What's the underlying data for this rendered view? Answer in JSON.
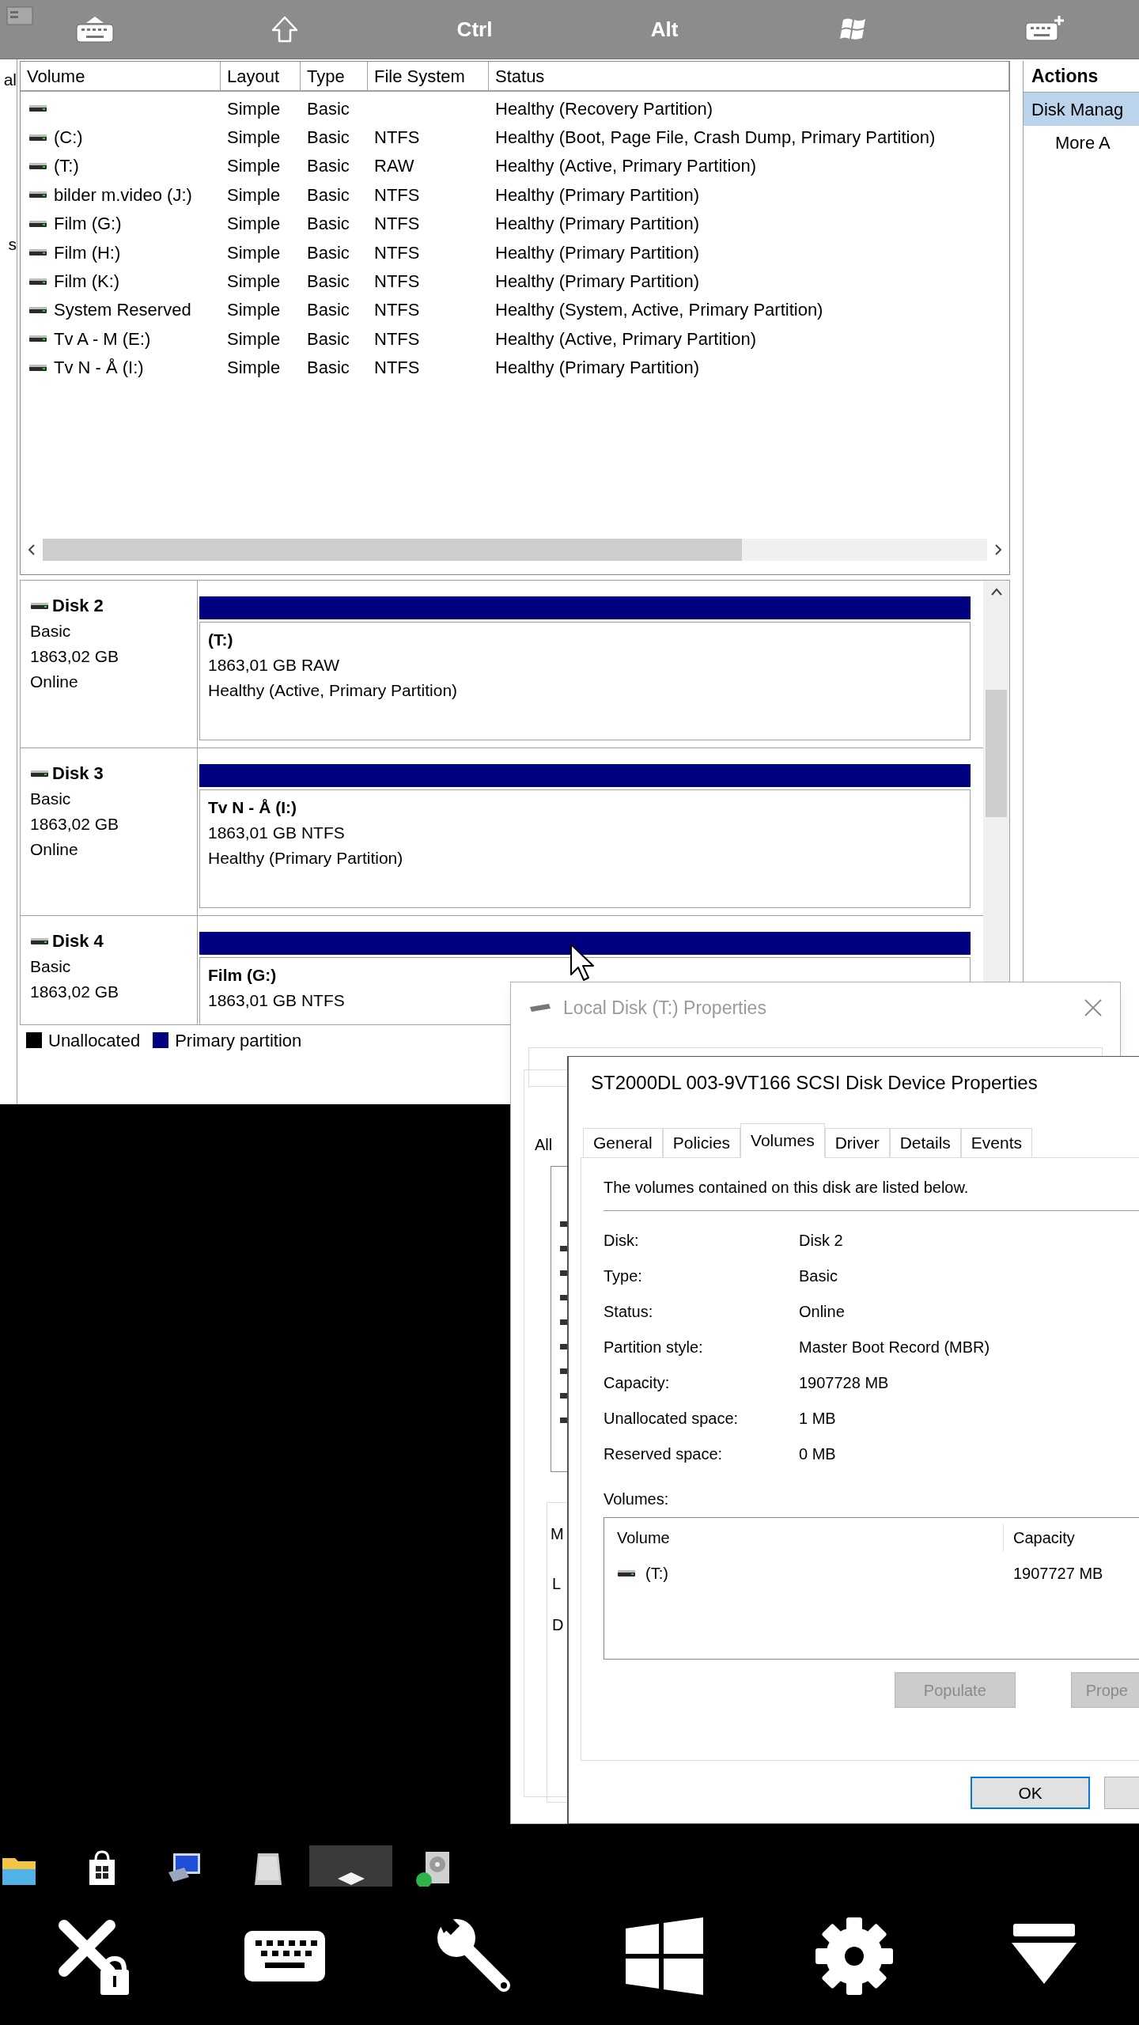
{
  "toolbar": {
    "keys": [
      {
        "kind": "keyboard"
      },
      {
        "kind": "shift"
      },
      {
        "kind": "text",
        "label": "Ctrl"
      },
      {
        "kind": "text",
        "label": "Alt"
      },
      {
        "kind": "windows"
      },
      {
        "kind": "keyboard-add"
      }
    ]
  },
  "left_pane": {
    "fragments": [
      "al",
      "s"
    ]
  },
  "volume_table": {
    "columns": [
      "Volume",
      "Layout",
      "Type",
      "File System",
      "Status"
    ],
    "rows": [
      {
        "layout": "Simple",
        "type": "Basic",
        "status": "Healthy (Recovery Partition)"
      },
      {
        "volume": "(C:)",
        "layout": "Simple",
        "type": "Basic",
        "file_system": "NTFS",
        "status": "Healthy (Boot, Page File, Crash Dump, Primary Partition)"
      },
      {
        "volume": "(T:)",
        "layout": "Simple",
        "type": "Basic",
        "file_system": "RAW",
        "status": "Healthy (Active, Primary Partition)"
      },
      {
        "volume": "bilder m.video (J:)",
        "layout": "Simple",
        "type": "Basic",
        "file_system": "NTFS",
        "status": "Healthy (Primary Partition)"
      },
      {
        "volume": "Film (G:)",
        "layout": "Simple",
        "type": "Basic",
        "file_system": "NTFS",
        "status": "Healthy (Primary Partition)"
      },
      {
        "volume": "Film (H:)",
        "layout": "Simple",
        "type": "Basic",
        "file_system": "NTFS",
        "status": "Healthy (Primary Partition)"
      },
      {
        "volume": "Film (K:)",
        "layout": "Simple",
        "type": "Basic",
        "file_system": "NTFS",
        "status": "Healthy (Primary Partition)"
      },
      {
        "volume": "System Reserved",
        "layout": "Simple",
        "type": "Basic",
        "file_system": "NTFS",
        "status": "Healthy (System, Active, Primary Partition)"
      },
      {
        "volume": "Tv A - M (E:)",
        "layout": "Simple",
        "type": "Basic",
        "file_system": "NTFS",
        "status": "Healthy (Active, Primary Partition)"
      },
      {
        "volume": "Tv N - Å (I:)",
        "layout": "Simple",
        "type": "Basic",
        "file_system": "NTFS",
        "status": "Healthy (Primary Partition)"
      }
    ]
  },
  "disks": [
    {
      "name": "Disk 2",
      "type": "Basic",
      "size": "1863,02 GB",
      "state": "Online",
      "partition": {
        "label": "(T:)",
        "size": "1863,01 GB RAW",
        "status": "Healthy (Active, Primary Partition)"
      }
    },
    {
      "name": "Disk 3",
      "type": "Basic",
      "size": "1863,02 GB",
      "state": "Online",
      "partition": {
        "label": "Tv N - Å (I:)",
        "size": "1863,01 GB NTFS",
        "status": "Healthy (Primary Partition)"
      }
    },
    {
      "name": "Disk 4",
      "type": "Basic",
      "size": "1863,02 GB",
      "partition": {
        "label": "Film (G:)",
        "size": "1863,01 GB NTFS"
      }
    }
  ],
  "legend": [
    {
      "label": "Unallocated",
      "color": "#000000"
    },
    {
      "label": "Primary partition",
      "color": "#000080"
    }
  ],
  "actions": {
    "title": "Actions",
    "items": [
      {
        "label": "Disk Manag",
        "selected": true
      },
      {
        "label": "More A",
        "selected": false
      }
    ]
  },
  "local_disk_dialog": {
    "title": "Local Disk (T:) Properties",
    "fragments": [
      "All",
      "M",
      "L",
      "D"
    ]
  },
  "disk_dialog": {
    "title": "ST2000DL 003-9VT166 SCSI Disk Device Properties",
    "tabs": [
      {
        "label": "General",
        "selected": false
      },
      {
        "label": "Policies",
        "selected": false
      },
      {
        "label": "Volumes",
        "selected": true
      },
      {
        "label": "Driver",
        "selected": false
      },
      {
        "label": "Details",
        "selected": false
      },
      {
        "label": "Events",
        "selected": false
      }
    ],
    "intro": "The volumes contained on this disk are listed below.",
    "properties": [
      {
        "label": "Disk:",
        "value": "Disk 2"
      },
      {
        "label": "Type:",
        "value": "Basic"
      },
      {
        "label": "Status:",
        "value": "Online"
      },
      {
        "label": "Partition style:",
        "value": "Master Boot Record (MBR)"
      },
      {
        "label": "Capacity:",
        "value": "1907728 MB"
      },
      {
        "label": "Unallocated space:",
        "value": "1 MB"
      },
      {
        "label": "Reserved space:",
        "value": "0 MB"
      }
    ],
    "volumes_label": "Volumes:",
    "volumes_columns": [
      "Volume",
      "Capacity"
    ],
    "volumes": [
      {
        "volume": "(T:)",
        "capacity": "1907727 MB"
      }
    ],
    "buttons": [
      {
        "label": "Populate",
        "disabled": true
      },
      {
        "label": "Prope",
        "disabled": true
      }
    ],
    "footer_buttons": [
      {
        "label": "OK",
        "default": true
      }
    ]
  },
  "taskbar": {
    "items": [
      {
        "kind": "folder",
        "selected": false
      },
      {
        "kind": "store",
        "selected": false
      },
      {
        "kind": "computer",
        "selected": false
      },
      {
        "kind": "drive",
        "selected": false
      },
      {
        "kind": "device",
        "selected": true
      },
      {
        "kind": "disk-tool",
        "selected": false
      }
    ]
  }
}
